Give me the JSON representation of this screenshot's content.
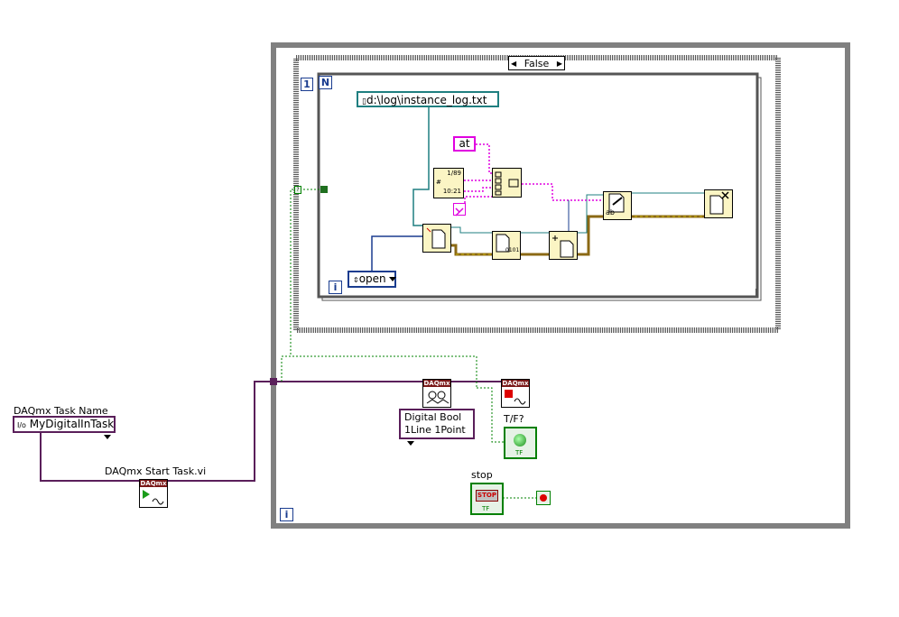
{
  "case_structure": {
    "selector_value": "False"
  },
  "for_loop": {
    "count_terminal": "N",
    "count_constant": "1",
    "iteration_terminal": "i"
  },
  "while_loop": {
    "iteration_terminal": "i"
  },
  "path_constant": {
    "value": "d:\\log\\instance_log.txt"
  },
  "string_constant": {
    "value": "at"
  },
  "open_enum": {
    "value": "open"
  },
  "date_node": {
    "lines": [
      "1/89",
      "#",
      "10:21"
    ]
  },
  "daqmx": {
    "header": "DAQmx",
    "task_label": "DAQmx Task Name",
    "task_value": "MyDigitalInTask",
    "task_prefix": "I/o",
    "start_label": "DAQmx Start Task.vi",
    "read_mode_line1": "Digital Bool",
    "read_mode_line2": "1Line 1Point"
  },
  "indicator": {
    "label": "T/F?",
    "type_text": "TF"
  },
  "stop_control": {
    "label": "stop",
    "button_text": "STOP",
    "type_text": "TF"
  },
  "file_node_text": {
    "binary": "0101",
    "write": "ab"
  },
  "colors": {
    "path_wire": "#1f7f80",
    "string_wire": "#e000e0",
    "file_wire": "#8b6914",
    "error_wire": "#c8b400",
    "numeric_wire": "#1a3c8f",
    "task_wire": "#5a1f5a",
    "bool_wire": "#008000"
  }
}
